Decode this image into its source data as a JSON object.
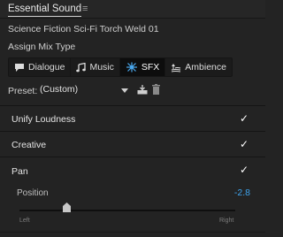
{
  "panel": {
    "title": "Essential Sound",
    "menu_glyph": "≡",
    "clip_name": "Science Fiction Sci-Fi Torch Weld 01",
    "assign_label": "Assign Mix Type"
  },
  "mix_types": [
    {
      "label": "Dialogue",
      "icon": "speech-bubble-icon",
      "active": false
    },
    {
      "label": "Music",
      "icon": "music-note-icon",
      "active": false
    },
    {
      "label": "SFX",
      "icon": "starburst-icon",
      "active": true
    },
    {
      "label": "Ambience",
      "icon": "ambience-icon",
      "active": false
    }
  ],
  "preset": {
    "label": "Preset:",
    "value": "(Custom)"
  },
  "sections": {
    "unify_loudness": {
      "label": "Unify Loudness",
      "checked": true
    },
    "creative": {
      "label": "Creative",
      "checked": true
    },
    "pan": {
      "label": "Pan",
      "checked": true
    }
  },
  "pan_slider": {
    "label": "Position",
    "value": "-2.8",
    "min_label": "Left",
    "max_label": "Right",
    "level": 0.22
  },
  "colors": {
    "accent": "#3ea4ee",
    "background": "#232323"
  }
}
